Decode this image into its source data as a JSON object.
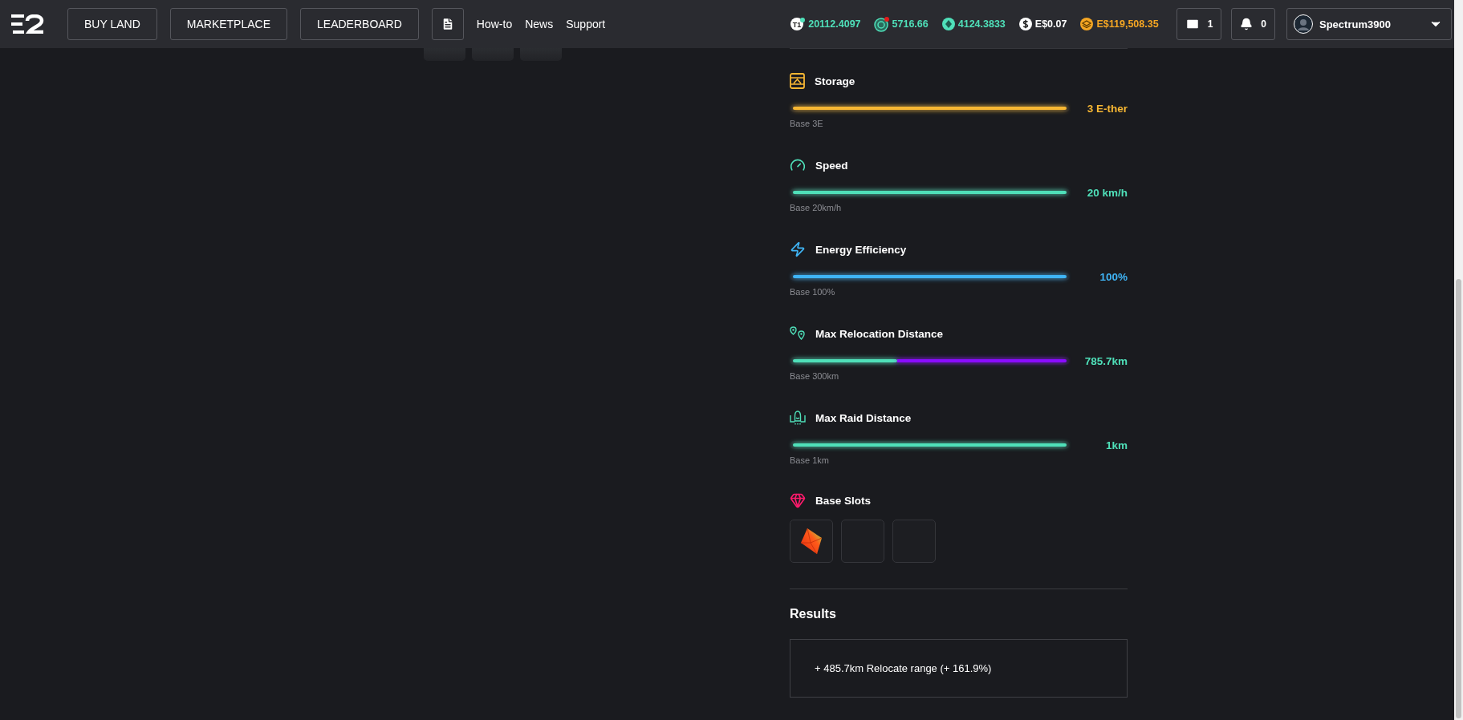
{
  "header": {
    "nav_buttons": [
      "BUY LAND",
      "MARKETPLACE",
      "LEADERBOARD"
    ],
    "links": [
      "How-to",
      "News",
      "Support"
    ],
    "balances": [
      {
        "kind": "t1",
        "badge": "T1",
        "value": "20112.4097",
        "color": "#4fe0b9"
      },
      {
        "kind": "radar",
        "value": "5716.66",
        "color": "#4fe0b9"
      },
      {
        "kind": "diamond",
        "value": "4124.3833",
        "color": "#4fe0b9"
      },
      {
        "kind": "dollar",
        "value": "E$0.07",
        "color": "#ffffff"
      },
      {
        "kind": "stack",
        "value": "E$119,508.35",
        "color": "#f5a623"
      }
    ],
    "mail_count": "1",
    "notification_count": "0",
    "username": "Spectrum3900"
  },
  "stats": [
    {
      "kind": "storage",
      "title": "Storage",
      "level": 1,
      "color": "#f7b733",
      "value": "3 E-ther",
      "base": "Base 3E"
    },
    {
      "kind": "speed",
      "title": "Speed",
      "level": 1,
      "color": "#4fe0b9",
      "value": "20 km/h",
      "base": "Base 20km/h"
    },
    {
      "kind": "energy",
      "title": "Energy Efficiency",
      "level": 1,
      "color": "#3fb4f5",
      "value": "100%",
      "base": "Base 100%"
    },
    {
      "kind": "relocation",
      "title": "Max Relocation Distance",
      "level": 0.382,
      "color": "#4fe0b9",
      "boost": {
        "color": "#8a0cff"
      },
      "value": "785.7km",
      "base": "Base 300km"
    },
    {
      "kind": "raid",
      "title": "Max Raid Distance",
      "level": 1,
      "color": "#4fe0b9",
      "value": "1km",
      "base": "Base 1km"
    }
  ],
  "base_slots": {
    "title": "Base Slots",
    "slots": [
      {
        "filled": true
      },
      {
        "filled": false
      },
      {
        "filled": false
      }
    ]
  },
  "results": {
    "title": "Results",
    "lines": [
      "+ 485.7km Relocate range (+ 161.9%)"
    ]
  }
}
